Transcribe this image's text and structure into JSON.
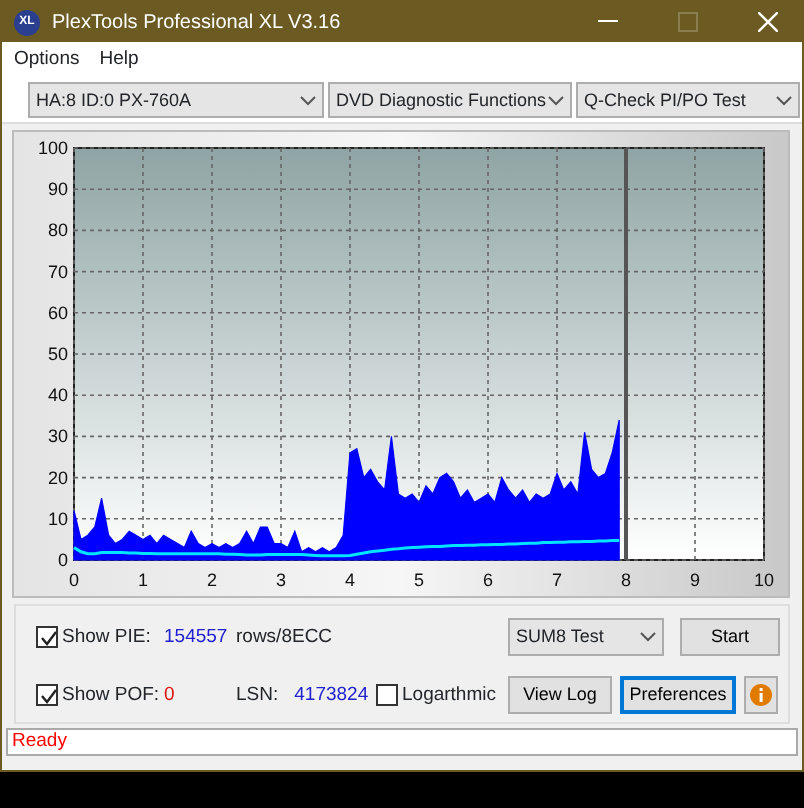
{
  "window": {
    "icon_text": "XL",
    "title": "PlexTools Professional XL V3.16"
  },
  "menu": [
    "Options",
    "Help"
  ],
  "toolbar": [
    {
      "value": "HA:8 ID:0  PX-760A"
    },
    {
      "value": "DVD Diagnostic Functions"
    },
    {
      "value": "Q-Check PI/PO Test"
    }
  ],
  "chart": {
    "chart_data": {
      "type": "area",
      "xlim": [
        0,
        10
      ],
      "ylim": [
        0,
        100
      ],
      "xticks": [
        0,
        1,
        2,
        3,
        4,
        5,
        6,
        7,
        8,
        9,
        10
      ],
      "yticks": [
        0,
        10,
        20,
        30,
        40,
        50,
        60,
        70,
        80,
        90,
        100
      ],
      "x": [
        0,
        0.1,
        0.2,
        0.3,
        0.4,
        0.5,
        0.6,
        0.7,
        0.8,
        0.9,
        1,
        1.1,
        1.2,
        1.3,
        1.4,
        1.5,
        1.6,
        1.7,
        1.8,
        1.9,
        2,
        2.1,
        2.2,
        2.3,
        2.4,
        2.5,
        2.6,
        2.7,
        2.8,
        2.9,
        3,
        3.1,
        3.2,
        3.3,
        3.4,
        3.5,
        3.6,
        3.7,
        3.8,
        3.9,
        4,
        4.1,
        4.2,
        4.3,
        4.4,
        4.5,
        4.6,
        4.7,
        4.8,
        4.9,
        5,
        5.1,
        5.2,
        5.3,
        5.4,
        5.5,
        5.6,
        5.7,
        5.8,
        5.9,
        6,
        6.1,
        6.2,
        6.3,
        6.4,
        6.5,
        6.6,
        6.7,
        6.8,
        6.9,
        7,
        7.1,
        7.2,
        7.3,
        7.4,
        7.5,
        7.6,
        7.7,
        7.8,
        7.9
      ],
      "series": [
        {
          "color": "#0000ff",
          "values": [
            12,
            5,
            6,
            8,
            15,
            6,
            4,
            5,
            7,
            6,
            5,
            6,
            4,
            6,
            5,
            4,
            3,
            7,
            4,
            3,
            4,
            3,
            4,
            3,
            4,
            7,
            4,
            8,
            8,
            4,
            4,
            3,
            7,
            2,
            3,
            2,
            3,
            2,
            3,
            6,
            26,
            27,
            20,
            22,
            19,
            17,
            30,
            16,
            15,
            16,
            14,
            18,
            16,
            20,
            21,
            19,
            15,
            17,
            14,
            15,
            16,
            14,
            20,
            17,
            15,
            17,
            14,
            16,
            15,
            16,
            21,
            17,
            19,
            16,
            31,
            22,
            20,
            21,
            26,
            34
          ]
        },
        {
          "color": "#00e5ff",
          "type": "line",
          "values": [
            3,
            2,
            1.5,
            1.5,
            1.8,
            1.8,
            1.8,
            1.8,
            1.7,
            1.7,
            1.6,
            1.6,
            1.5,
            1.5,
            1.5,
            1.5,
            1.5,
            1.5,
            1.5,
            1.5,
            1.5,
            1.5,
            1.4,
            1.4,
            1.3,
            1.2,
            1.2,
            1.2,
            1.3,
            1.3,
            1.3,
            1.3,
            1.3,
            1.3,
            1.2,
            1.1,
            1,
            1,
            1,
            1,
            1.1,
            1.4,
            1.7,
            2,
            2.2,
            2.4,
            2.6,
            2.7,
            2.9,
            3,
            3.1,
            3.2,
            3.3,
            3.3,
            3.4,
            3.5,
            3.5,
            3.6,
            3.6,
            3.7,
            3.7,
            3.8,
            3.8,
            3.9,
            3.9,
            4,
            4.1,
            4.1,
            4.2,
            4.2,
            4.3,
            4.3,
            4.4,
            4.4,
            4.5,
            4.5,
            4.6,
            4.6,
            4.7,
            4.7
          ]
        }
      ],
      "grid": true,
      "ref_lines": [
        {
          "axis": "x",
          "value": 8
        }
      ]
    }
  },
  "controls": {
    "show_pie": {
      "label": "Show PIE:",
      "checked": true,
      "value": "154557",
      "unit": "rows/8ECC"
    },
    "show_pof": {
      "label": "Show POF:",
      "checked": true,
      "value": "0"
    },
    "lsn": {
      "label": "LSN:",
      "value": "4173824"
    },
    "logarithmic": {
      "label": "Logarthmic",
      "checked": false
    },
    "test_select": {
      "value": "SUM8 Test"
    },
    "buttons": [
      {
        "label": "Start",
        "focused": false
      },
      {
        "label": "View Log",
        "focused": false
      },
      {
        "label": "Preferences",
        "focused": true
      }
    ]
  },
  "status_bar": "Ready"
}
